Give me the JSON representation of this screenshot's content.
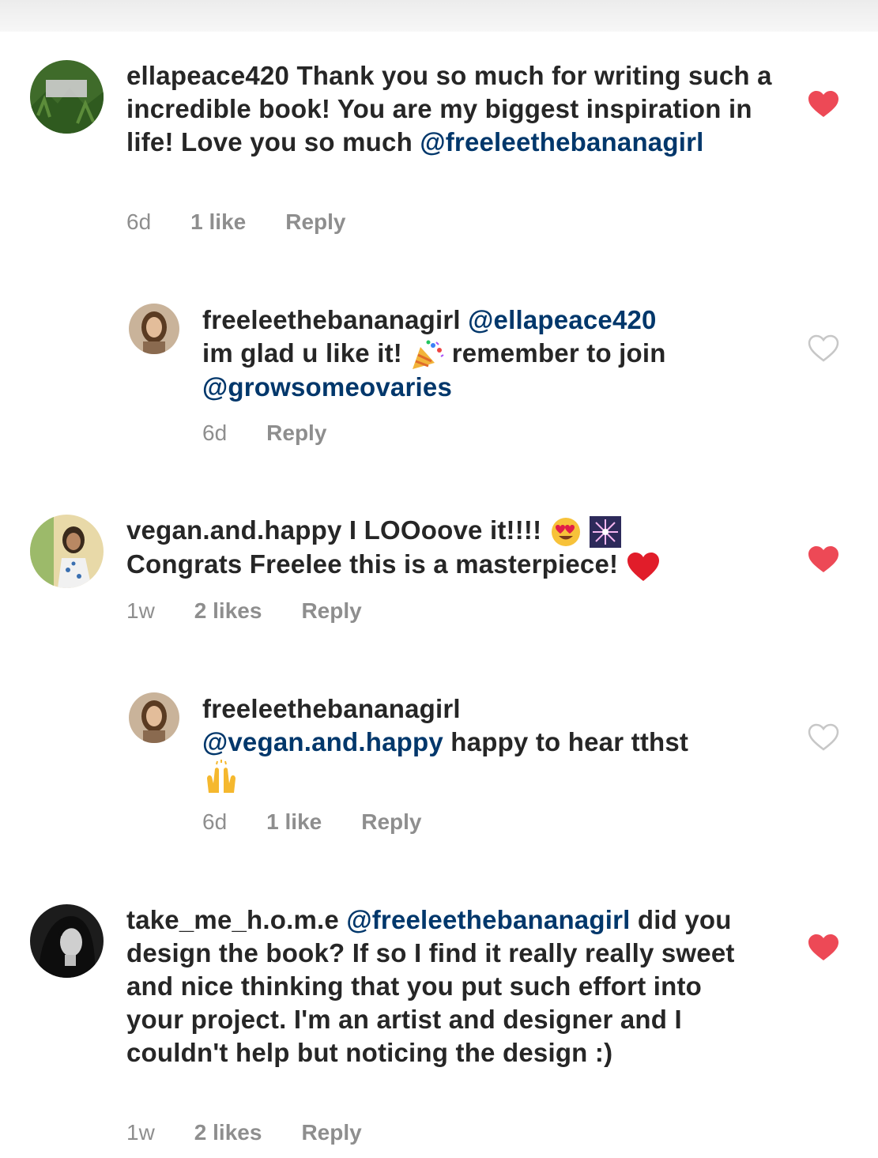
{
  "colors": {
    "mention": "#00376b",
    "meta": "#8e8e8e",
    "heart_liked": "#ed4956",
    "heart_unliked": "#c7c7c7"
  },
  "comments": [
    {
      "username": "ellapeace420",
      "body": " Thank you so much for writing such a incredible book! You are my biggest inspiration in life! Love you so much ",
      "mention": "@freeleethebananagirl",
      "time": "6d",
      "likes": "1 like",
      "reply": "Reply",
      "liked": true
    },
    {
      "username": "freeleethebananagirl",
      "mention": " @ellapeace420",
      "body1": "im glad u like it! ",
      "emoji1": "party-popper-emoji",
      "body2": " remember to join ",
      "mention2": "@growsomeovaries",
      "time": "6d",
      "reply": "Reply",
      "liked": false
    },
    {
      "username": "vegan.and.happy",
      "body1": " I LOOoove it!!!! ",
      "emoji1": "heart-eyes-emoji",
      "emoji2": "firework-emoji",
      "body2": "Congrats Freelee this is a masterpiece! ",
      "emoji3": "red-heart-emoji",
      "time": "1w",
      "likes": "2 likes",
      "reply": "Reply",
      "liked": true
    },
    {
      "username": "freeleethebananagirl",
      "mention": "@vegan.and.happy",
      "body": " happy to hear tthst",
      "emoji1": "raising-hands-emoji",
      "time": "6d",
      "likes": "1 like",
      "reply": "Reply",
      "liked": false
    },
    {
      "username": "take_me_h.o.m.e",
      "mention": " @freeleethebananagirl",
      "body": " did you design the book? If so I find it really really sweet and nice thinking that you put such effort into your project. I'm an artist and designer and I couldn't help but noticing the design :)",
      "time": "1w",
      "likes": "2 likes",
      "reply": "Reply",
      "liked": true
    }
  ]
}
